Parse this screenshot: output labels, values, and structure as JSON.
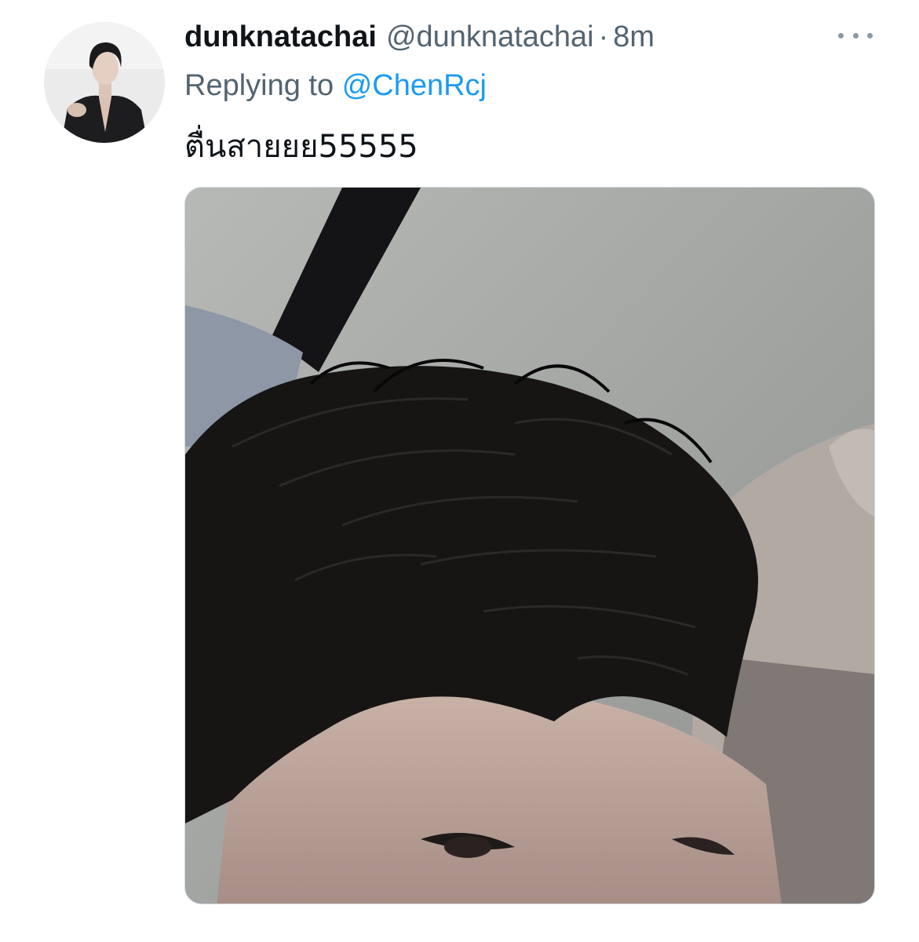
{
  "tweet": {
    "display_name": "dunknatachai",
    "handle": "@dunknatachai",
    "separator": "·",
    "time": "8m",
    "reply_prefix": "Replying to",
    "reply_to": "@ChenRcj",
    "text": "ตื่นสายยย55555",
    "more_icon": "ellipsis-icon"
  },
  "colors": {
    "text_primary": "#0f1419",
    "text_secondary": "#536471",
    "link": "#1d9bf0"
  }
}
